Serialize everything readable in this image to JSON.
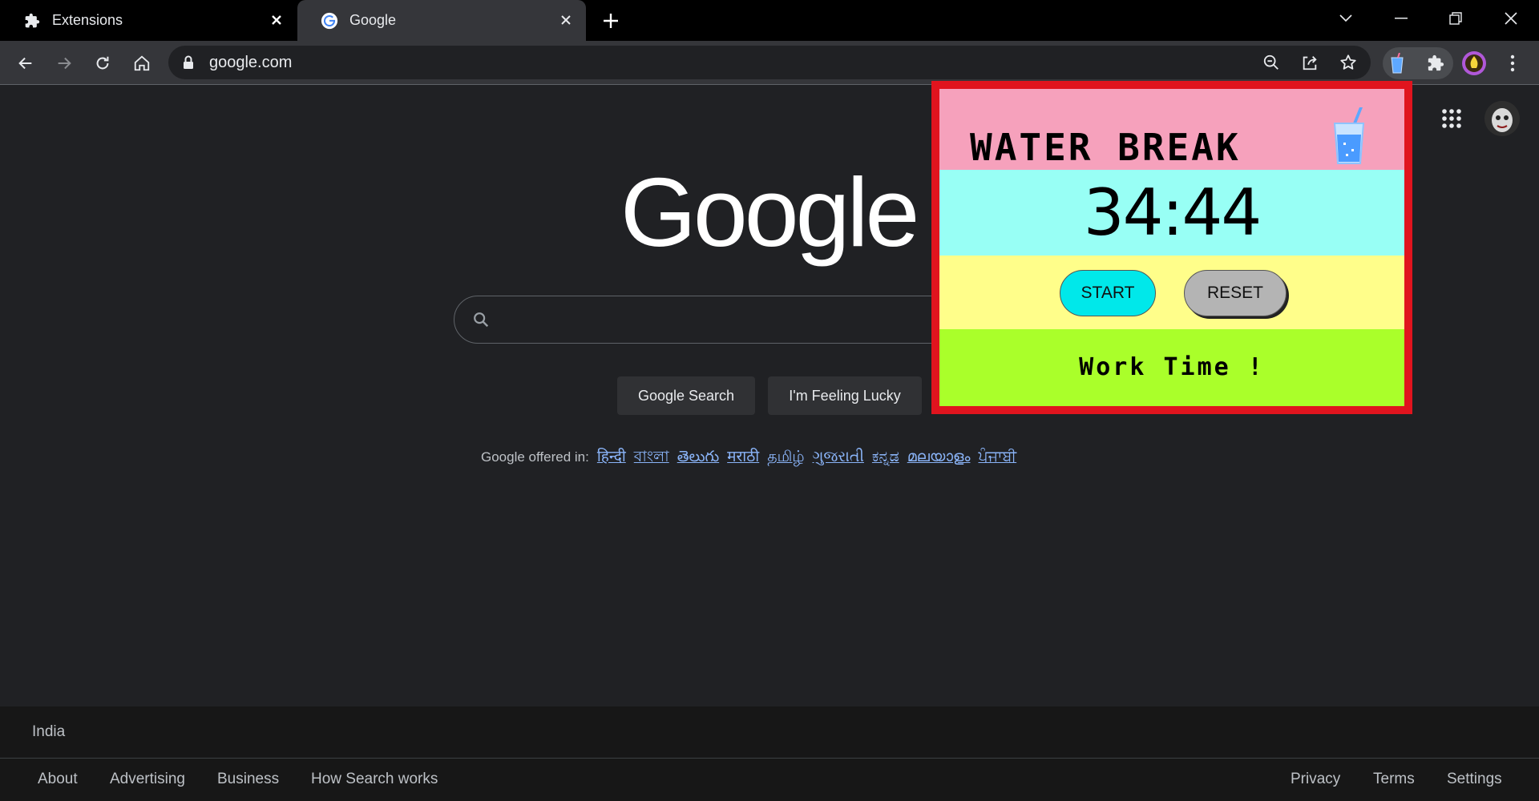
{
  "tabs": [
    {
      "title": "Extensions",
      "icon": "puzzle-icon"
    },
    {
      "title": "Google",
      "icon": "google-g-icon"
    }
  ],
  "toolbar": {
    "url": "google.com"
  },
  "google": {
    "logo_text": "Google",
    "search_button": "Google Search",
    "lucky_button": "I'm Feeling Lucky",
    "offered_label": "Google offered in:",
    "languages": [
      "हिन्दी",
      "বাংলা",
      "తెలుగు",
      "मराठी",
      "தமிழ்",
      "ગુજરાતી",
      "ಕನ್ನಡ",
      "മലയാളം",
      "ਪੰਜਾਬੀ"
    ]
  },
  "footer": {
    "country": "India",
    "left_links": [
      "About",
      "Advertising",
      "Business",
      "How Search works"
    ],
    "right_links": [
      "Privacy",
      "Terms",
      "Settings"
    ]
  },
  "popup": {
    "title": "WATER BREAK",
    "timer": "34:44",
    "start_label": "START",
    "reset_label": "RESET",
    "status": "Work Time !",
    "colors": {
      "border": "#e0141e",
      "title_band": "#f6a1bc",
      "timer_band": "#98fff5",
      "buttons_band": "#fffe8a",
      "status_band": "#aaff2a",
      "start_button": "#00e8ea",
      "reset_button": "#b4b4b4"
    }
  }
}
